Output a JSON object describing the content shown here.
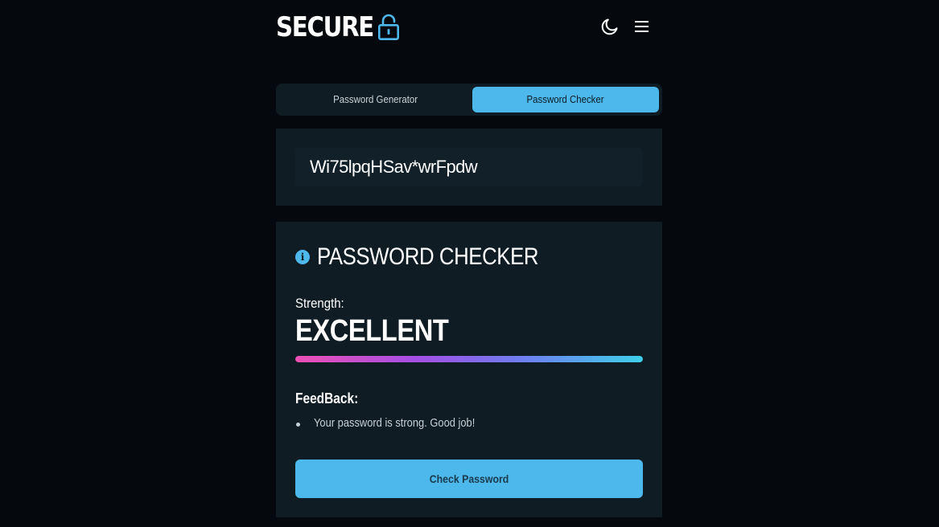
{
  "app": {
    "logo_text": "SECURE"
  },
  "header": {
    "icons": [
      "lock-open-icon",
      "moon-icon",
      "menu-icon"
    ]
  },
  "tabs": [
    {
      "label": "Password Generator",
      "active": false
    },
    {
      "label": "Password Checker",
      "active": true
    }
  ],
  "password": {
    "value": "Wi75lpqHSav*wrFpdw"
  },
  "checker": {
    "title": "PASSWORD CHECKER",
    "strength_label": "Strength:",
    "strength_value": "EXCELLENT",
    "strength_level": 1.0,
    "feedback_label": "FeedBack:",
    "feedback_items": [
      "Your password is strong. Good job!"
    ],
    "button_label": "Check Password"
  },
  "colors": {
    "accent": "#4db8eb",
    "background": "#05090d",
    "panel": "#0f1c24",
    "gradient": [
      "#ee4fb3",
      "#a34fe6",
      "#6f7df0",
      "#3ed0ea"
    ]
  }
}
